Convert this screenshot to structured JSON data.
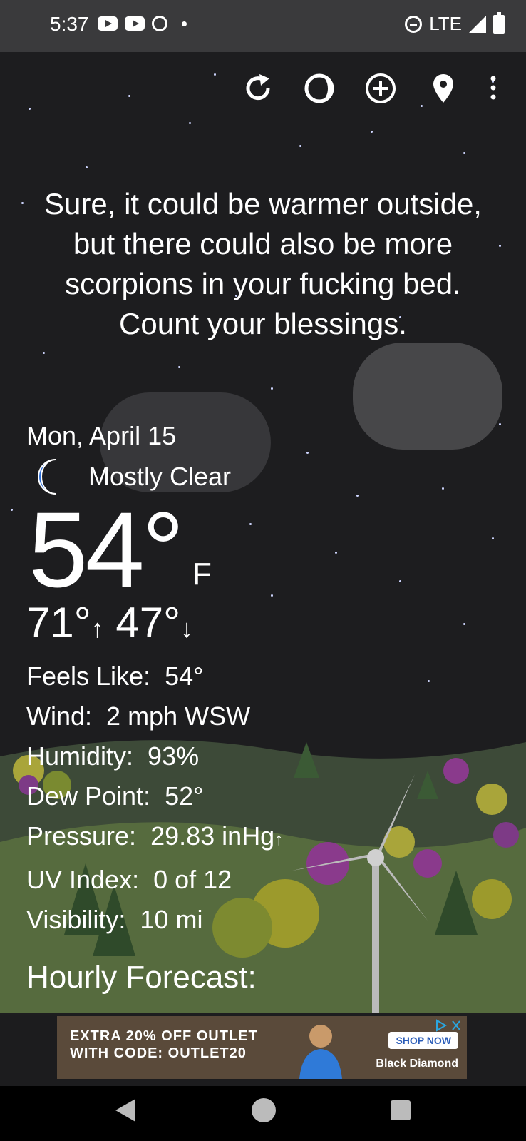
{
  "status": {
    "time": "5:37",
    "network": "LTE"
  },
  "quote": "Sure, it could be warmer outside, but there could also be more scorpions in your fucking bed. Count your blessings.",
  "weather": {
    "date": "Mon, April 15",
    "condition": "Mostly Clear",
    "condition_icon": "crescent-moon-icon",
    "temp": "54°",
    "unit": "F",
    "high": "71°",
    "low": "47°",
    "details": [
      {
        "label": "Feels Like:",
        "value": "54°"
      },
      {
        "label": "Wind:",
        "value": "2 mph WSW"
      },
      {
        "label": "Humidity:",
        "value": "93%"
      },
      {
        "label": "Dew Point:",
        "value": "52°"
      },
      {
        "label": "Pressure:",
        "value": "29.83 inHg"
      },
      {
        "label": "UV Index:",
        "value": "0 of 12"
      },
      {
        "label": "Visibility:",
        "value": "10 mi"
      }
    ],
    "pressure_trend_icon": "arrow-up-icon"
  },
  "hourly_title": "Hourly Forecast:",
  "toolbar": {
    "icons": [
      "refresh-icon",
      "moon-phase-icon",
      "add-location-icon",
      "location-pin-icon",
      "more-icon"
    ]
  },
  "ad": {
    "line1": "EXTRA 20% OFF OUTLET",
    "line2": "WITH CODE: OUTLET20",
    "cta": "SHOP NOW",
    "brand": "Black Diamond"
  },
  "colors": {
    "background": "#1c1c1e",
    "status_bar": "#3a3a3c",
    "moon": "#2e6fd8",
    "cloud": "#4a4a4c"
  }
}
